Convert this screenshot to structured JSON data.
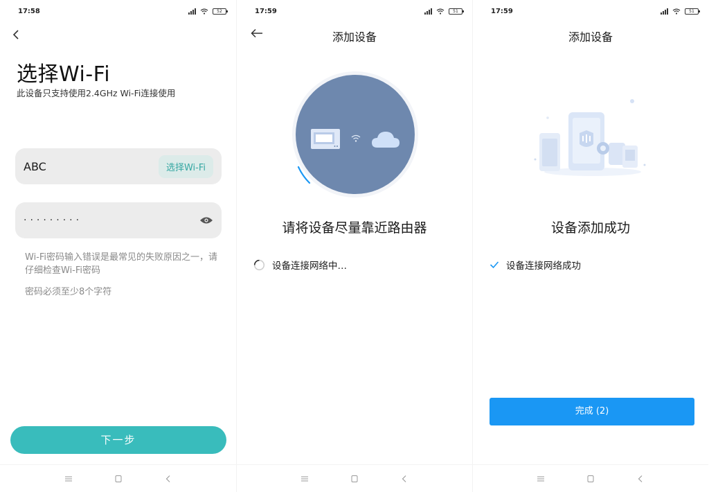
{
  "screens": [
    {
      "status": {
        "time": "17:58",
        "battery": "52"
      },
      "title": "选择Wi-Fi",
      "subtitle": "此设备只支持使用2.4GHz Wi-Fi连接使用",
      "ssid": "ABC",
      "choose_wifi_label": "选择Wi-Fi",
      "password_masked": "·········",
      "hint_wrong_password": "Wi-Fi密码输入错误是最常见的失败原因之一，请仔细检查Wi-Fi密码",
      "hint_min_length": "密码必须至少8个字符",
      "next_label": "下一步",
      "icons": {
        "back": "chevron-left-icon",
        "eye": "eye-icon"
      },
      "colors": {
        "accent": "#39bcbc"
      }
    },
    {
      "status": {
        "time": "17:59",
        "battery": "51"
      },
      "title": "添加设备",
      "message": "请将设备尽量靠近路由器",
      "progress_text": "设备连接网络中…",
      "icons": {
        "back": "arrow-left-icon",
        "spinner": "loading-spinner-icon"
      },
      "colors": {
        "circle": "#6e88ae",
        "spinner": "#1a97f4"
      }
    },
    {
      "status": {
        "time": "17:59",
        "battery": "51"
      },
      "title": "添加设备",
      "message": "设备添加成功",
      "success_text": "设备连接网络成功",
      "done_label": "完成 (2)",
      "icons": {
        "check": "check-icon"
      },
      "colors": {
        "primary": "#1a97f4"
      }
    }
  ]
}
